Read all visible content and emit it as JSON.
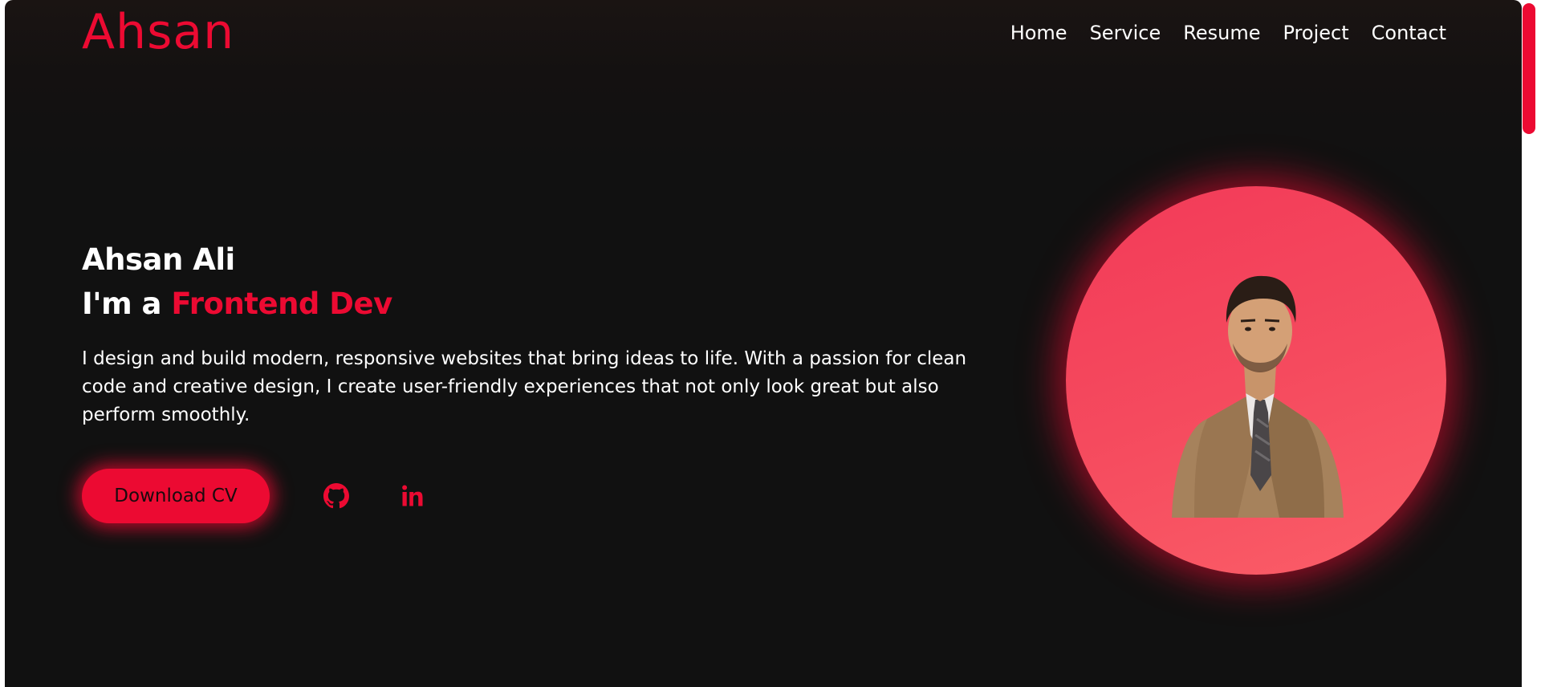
{
  "header": {
    "brand": "Ahsan",
    "nav": [
      {
        "label": "Home"
      },
      {
        "label": "Service"
      },
      {
        "label": "Resume"
      },
      {
        "label": "Project"
      },
      {
        "label": "Contact"
      }
    ]
  },
  "hero": {
    "name": "Ahsan Ali",
    "role_prefix": "I'm a ",
    "role_accent": "Frontend Dev",
    "description": "I design and build modern, responsive websites that bring ideas to life. With a passion for clean code and creative design, I create user-friendly experiences that not only look great but also perform smoothly.",
    "cv_button": "Download CV",
    "social": [
      {
        "icon": "github-icon"
      },
      {
        "icon": "linkedin-icon"
      }
    ],
    "avatar_icon": "profile-photo"
  },
  "theme": {
    "accent": "#ec0a32",
    "background": "#111111",
    "text": "#ffffff"
  }
}
